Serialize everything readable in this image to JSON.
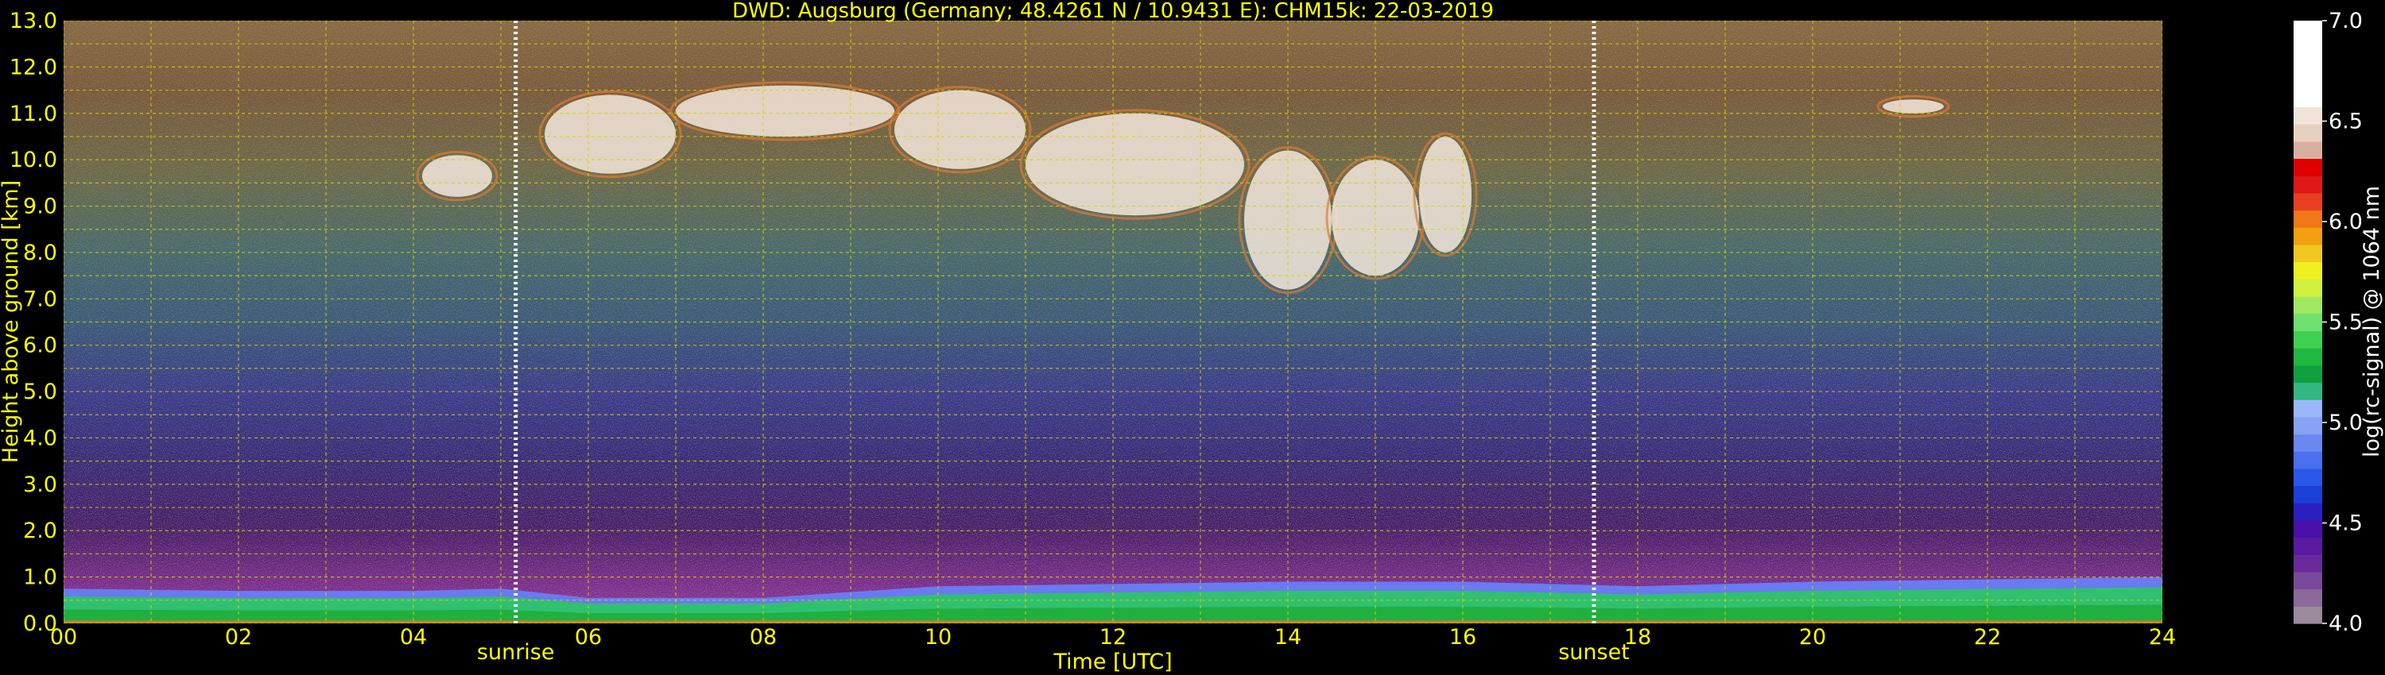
{
  "chart_data": {
    "type": "heatmap",
    "title": "DWD: Augsburg (Germany; 48.4261 N / 10.9431 E):    CHM15k: 22-03-2019",
    "xlabel": "Time [UTC]",
    "ylabel": "Height above ground [km]",
    "xlim": [
      0,
      24
    ],
    "ylim": [
      0,
      13
    ],
    "x_ticks": [
      "00",
      "02",
      "04",
      "06",
      "08",
      "10",
      "12",
      "14",
      "16",
      "18",
      "20",
      "22",
      "24"
    ],
    "y_ticks": [
      "0.0",
      "1.0",
      "2.0",
      "3.0",
      "4.0",
      "5.0",
      "6.0",
      "7.0",
      "8.0",
      "9.0",
      "10.0",
      "11.0",
      "12.0",
      "13.0"
    ],
    "grid": true,
    "colorbar": {
      "label": "log(rc-signal) @ 1064 nm",
      "range": [
        4.0,
        7.0
      ],
      "ticks": [
        "4.0",
        "4.5",
        "5.0",
        "5.5",
        "6.0",
        "6.5",
        "7.0"
      ],
      "colors": [
        "#9a8a9a",
        "#8a6a9a",
        "#7a4a9a",
        "#6a2a9a",
        "#5a1aa0",
        "#4a10aa",
        "#2a20c0",
        "#1a40d8",
        "#2a58e8",
        "#4a70f0",
        "#6a88f0",
        "#8aa2f4",
        "#9ab8f8",
        "#30b880",
        "#10a040",
        "#20b840",
        "#40d050",
        "#70e070",
        "#a0e860",
        "#d0f040",
        "#f0f020",
        "#f0c820",
        "#f0a010",
        "#f07818",
        "#e84020",
        "#e01818",
        "#e00000",
        "#d8b0a0",
        "#e8d0c0",
        "#f0e4d8",
        "#ffffff",
        "#ffffff",
        "#ffffff",
        "#ffffff",
        "#ffffff"
      ]
    },
    "events": [
      {
        "label": "sunrise",
        "time": 5.17
      },
      {
        "label": "sunset",
        "time": 17.5
      }
    ],
    "boundary_layer_top_km": {
      "time": [
        0,
        2,
        4,
        5,
        6,
        8,
        10,
        12,
        14,
        16,
        18,
        20,
        22,
        24
      ],
      "height": [
        0.75,
        0.7,
        0.7,
        0.75,
        0.55,
        0.55,
        0.8,
        0.85,
        0.9,
        0.9,
        0.8,
        0.9,
        0.95,
        1.0
      ]
    },
    "cirrus_cloud_segments_km": [
      {
        "start": 4.1,
        "end": 4.9,
        "base": 9.2,
        "top": 10.1
      },
      {
        "start": 5.5,
        "end": 7.0,
        "base": 9.7,
        "top": 11.4
      },
      {
        "start": 7.0,
        "end": 9.5,
        "base": 10.5,
        "top": 11.6
      },
      {
        "start": 9.5,
        "end": 11.0,
        "base": 9.8,
        "top": 11.5
      },
      {
        "start": 11.0,
        "end": 13.5,
        "base": 8.8,
        "top": 11.0
      },
      {
        "start": 13.5,
        "end": 14.5,
        "base": 7.2,
        "top": 10.2
      },
      {
        "start": 14.5,
        "end": 15.5,
        "base": 7.5,
        "top": 10.0
      },
      {
        "start": 15.5,
        "end": 16.1,
        "base": 8.0,
        "top": 10.5
      },
      {
        "start": 20.8,
        "end": 21.5,
        "base": 11.0,
        "top": 11.3
      }
    ]
  }
}
